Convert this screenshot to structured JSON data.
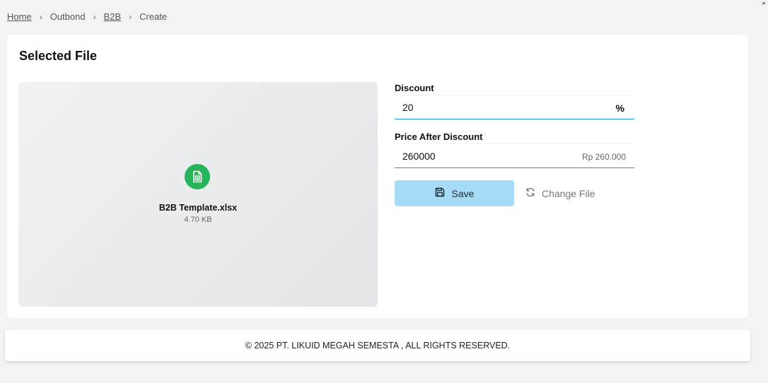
{
  "breadcrumb": {
    "home": "Home",
    "outbond": "Outbond",
    "b2b": "B2B",
    "create": "Create",
    "separator": "›"
  },
  "card": {
    "title": "Selected File"
  },
  "file": {
    "name": "B2B Template.xlsx",
    "size": "4.70 KB",
    "icon": "spreadsheet-file-icon",
    "icon_color": "#26b45a"
  },
  "form": {
    "discount": {
      "label": "Discount",
      "value": "20",
      "suffix": "%"
    },
    "price_after_discount": {
      "label": "Price After Discount",
      "value": "260000",
      "formatted": "Rp 260.000"
    },
    "save_label": "Save",
    "change_file_label": "Change File"
  },
  "footer": {
    "text": "© 2025 PT. LIKUID MEGAH SEMESTA , ALL RIGHTS RESERVED."
  },
  "colors": {
    "accent": "#1e9bd7",
    "save_button": "#a7dcf6",
    "background": "#f3f3f4"
  }
}
